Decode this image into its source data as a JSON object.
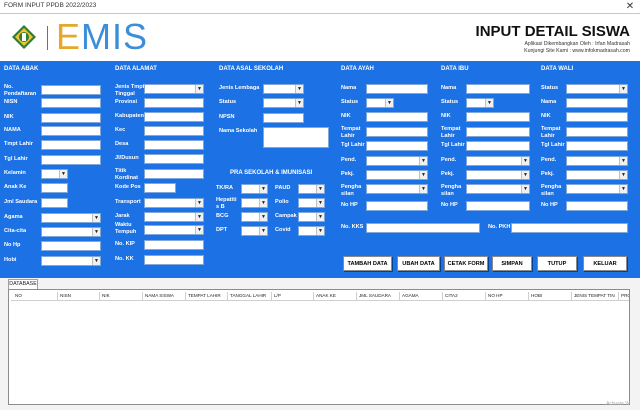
{
  "window": {
    "title": "FORM INPUT PPDB 2022/2023",
    "close_label": "✕"
  },
  "header": {
    "logo_text": "EMIS",
    "title": "INPUT DETAIL SISWA",
    "sub1": "Aplikasi Dikembangkan Oleh : Irfan Madrasah",
    "sub2": "Kunjungi Site Kami : www.infokmadrasah.com"
  },
  "colors": {
    "panel": "#1c71e4",
    "emis_gold": "#e6a82b",
    "emis_blue": "#3b8fd8",
    "emblem_green": "#2f7d32"
  },
  "sections": {
    "abak": "DATA ABAK",
    "alamat": "DATA ALAMAT",
    "asal": "DATA ASAL SEKOLAH",
    "ayah": "DATA AYAH",
    "ibu": "DATA IBU",
    "wali": "DATA WALI",
    "pra": "PRA SEKOLAH & IMUNISASI"
  },
  "abak": {
    "no_pendaftaran": "No. Pendaftaran",
    "nisn": "NISN",
    "nik": "NIK",
    "nama": "NAMA",
    "tempat_lahir": "Tmpt Lahir",
    "tgl_lahir": "Tgl Lahir",
    "kelamin": "Kelamin",
    "anak_ke": "Anak Ke",
    "jml_saudara": "Jml Saudara",
    "agama": "Agama",
    "cita": "Cita-cita",
    "no_hp": "No Hp",
    "hobi": "Hobi"
  },
  "alamat": {
    "jenis_tinggal": "Jenis Tmpt Tinggal",
    "provinsi": "Provinsi",
    "kabupaten": "Kabupaten",
    "kec": "Kec",
    "desa": "Desa",
    "rt": "Jl/Dusun",
    "titik": "Titik Kordinat",
    "kodepos": "Kode Pos",
    "transport": "Transport",
    "jarak": "Jarak",
    "waktu": "Waktu Tempuh",
    "kip": "No. KIP",
    "kk": "No. KK"
  },
  "asal": {
    "jenis_lembaga": "Jenis Lembaga",
    "status": "Status",
    "npsn": "NPSN",
    "nama_sekolah": "Nama Sekolah"
  },
  "pra": {
    "tkra": "TK/RA",
    "paud": "PAUD",
    "hepatitis": "Hepatiti s B",
    "polio": "Polio",
    "bcg": "BCG",
    "campak": "Campak",
    "dpt": "DPT",
    "covid": "Covid"
  },
  "ortu": {
    "nama": "Nama",
    "status": "Status",
    "nik": "NIK",
    "tempat_lahir": "Tempat Lahir",
    "tgl_lahir": "Tgl Lahir",
    "pend": "Pend.",
    "pekj": "Pekj.",
    "penghasilan": "Pengha silan",
    "no_hp": "No HP"
  },
  "kks": {
    "label": "No. KKS",
    "pkh_label": "No. PKH"
  },
  "buttons": {
    "tambah": "TAMBAH DATA",
    "ubah": "UBAH DATA",
    "cetak": "CETAK FORM",
    "simpan": "SIMPAN",
    "tutup": "TUTUP",
    "keluar": "KELUAR"
  },
  "database": {
    "tab_label": "DATABASE",
    "columns": [
      "NO",
      "NISN",
      "NIK",
      "NAMA SISWA",
      "TEMPAT LAHIR",
      "TANGGAL LAHIR",
      "L/P",
      "ANAK KE",
      "JML SAUDARA",
      "AGAMA",
      "CITA2",
      "NO HP",
      "HOBI",
      "JENIS TEMPAT TIN",
      "PROVI"
    ]
  },
  "watermark": "Activate W"
}
